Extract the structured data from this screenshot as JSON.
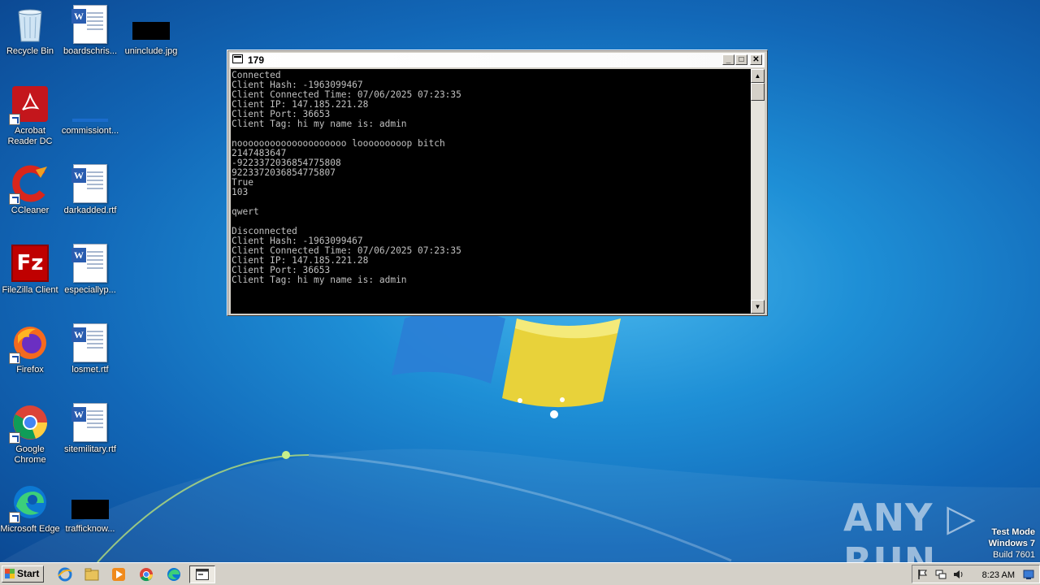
{
  "desktop": {
    "icons": [
      {
        "label": "Recycle Bin",
        "icon": "recycle-bin-icon"
      },
      {
        "label": "boardschris...",
        "icon": "word-document-icon"
      },
      {
        "label": "uninclude.jpg",
        "icon": "image-file-icon"
      },
      {
        "label": "Acrobat Reader DC",
        "icon": "acrobat-icon"
      },
      {
        "label": "commissiont...",
        "icon": "file-icon"
      },
      {
        "label": "CCleaner",
        "icon": "ccleaner-icon"
      },
      {
        "label": "darkadded.rtf",
        "icon": "word-document-icon"
      },
      {
        "label": "FileZilla Client",
        "icon": "filezilla-icon"
      },
      {
        "label": "especiallyp...",
        "icon": "word-document-icon"
      },
      {
        "label": "Firefox",
        "icon": "firefox-icon"
      },
      {
        "label": "losmet.rtf",
        "icon": "word-document-icon"
      },
      {
        "label": "Google Chrome",
        "icon": "chrome-icon"
      },
      {
        "label": "sitemilitary.rtf",
        "icon": "word-document-icon"
      },
      {
        "label": "Microsoft Edge",
        "icon": "edge-icon"
      },
      {
        "label": "trafficknow...",
        "icon": "image-file-icon"
      }
    ]
  },
  "console": {
    "title": "179",
    "text": "Connected\nClient Hash: -1963099467\nClient Connected Time: 07/06/2025 07:23:35\nClient IP: 147.185.221.28\nClient Port: 36653\nClient Tag: hi my name is: admin\n\nnoooooooooooooooooooo looooooooop bitch\n2147483647\n-9223372036854775808\n9223372036854775807\nTrue\n103\n\nqwert\n\nDisconnected\nClient Hash: -1963099467\nClient Connected Time: 07/06/2025 07:23:35\nClient IP: 147.185.221.28\nClient Port: 36653\nClient Tag: hi my name is: admin"
  },
  "watermark": {
    "brand": "ANY ▷ RUN",
    "test_mode": "Test Mode",
    "os": "Windows 7",
    "build": "Build 7601"
  },
  "taskbar": {
    "start_label": "Start",
    "clock": "8:23 AM"
  }
}
